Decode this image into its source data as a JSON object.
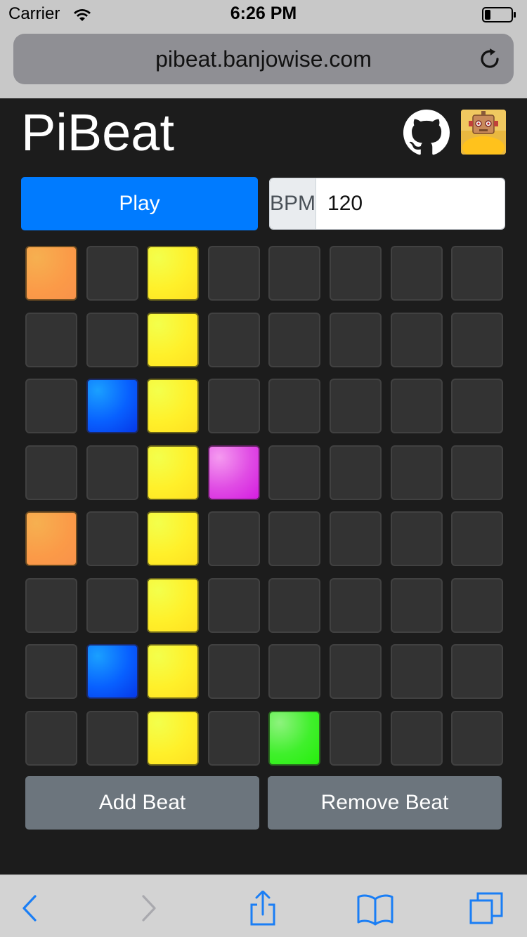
{
  "status_bar": {
    "carrier": "Carrier",
    "time": "6:26 PM",
    "icons": [
      "wifi-icon",
      "battery-icon"
    ]
  },
  "browser": {
    "url": "pibeat.banjowise.com",
    "reload_icon": "reload-icon",
    "toolbar_icons": [
      "back-icon",
      "forward-icon",
      "share-icon",
      "bookmarks-icon",
      "tabs-icon"
    ]
  },
  "header": {
    "title": "PiBeat",
    "github_icon": "github-icon",
    "avatar": "robot-avatar"
  },
  "controls": {
    "play_label": "Play",
    "bpm_label": "BPM",
    "bpm_value": "120"
  },
  "sequencer": {
    "rows": 8,
    "columns": 8,
    "colors": {
      "off": "#333333",
      "orange": "#fb9a48",
      "yellow": "#fff02a",
      "blue": "#0860ff",
      "magenta": "#e04ce4",
      "green": "#40f02c"
    },
    "grid": [
      [
        "orange",
        "off",
        "yellow",
        "off",
        "off",
        "off",
        "off",
        "off"
      ],
      [
        "off",
        "off",
        "yellow",
        "off",
        "off",
        "off",
        "off",
        "off"
      ],
      [
        "off",
        "blue",
        "yellow",
        "off",
        "off",
        "off",
        "off",
        "off"
      ],
      [
        "off",
        "off",
        "yellow",
        "magenta",
        "off",
        "off",
        "off",
        "off"
      ],
      [
        "orange",
        "off",
        "yellow",
        "off",
        "off",
        "off",
        "off",
        "off"
      ],
      [
        "off",
        "off",
        "yellow",
        "off",
        "off",
        "off",
        "off",
        "off"
      ],
      [
        "off",
        "blue",
        "yellow",
        "off",
        "off",
        "off",
        "off",
        "off"
      ],
      [
        "off",
        "off",
        "yellow",
        "off",
        "green",
        "off",
        "off",
        "off"
      ]
    ]
  },
  "actions": {
    "add_beat_label": "Add Beat",
    "remove_beat_label": "Remove Beat"
  }
}
